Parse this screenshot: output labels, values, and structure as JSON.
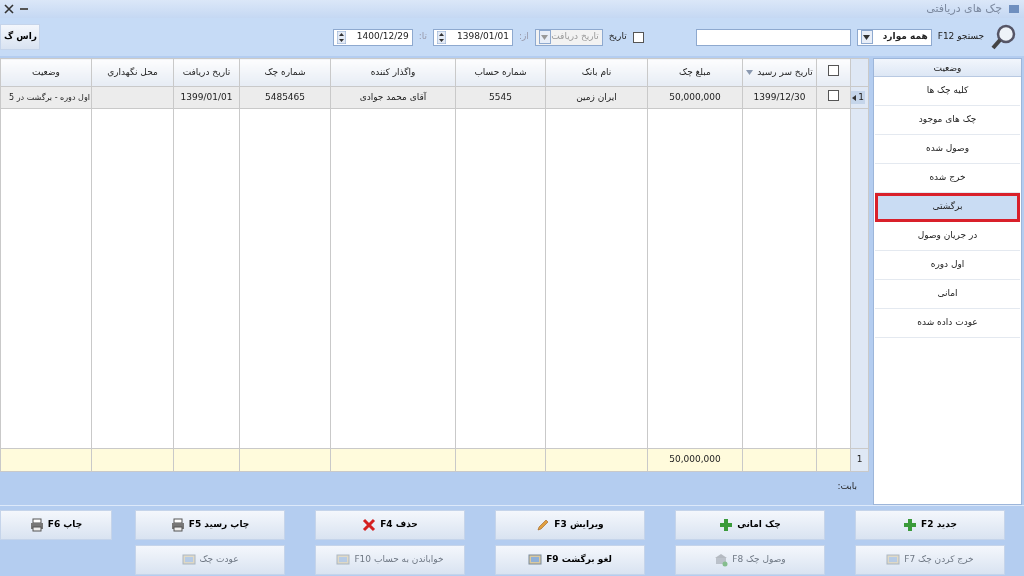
{
  "window": {
    "title": "چک های دریافتی"
  },
  "toolbar": {
    "search_label": "جستجو F12",
    "scope": "همه موارد",
    "date_filter": {
      "label": "تاریخ",
      "checked": false
    },
    "date_field": "تاریخ دریافت",
    "from_label": "از:",
    "from": "1398/01/01",
    "to_label": "تا:",
    "to": "1400/12/29",
    "side_button": "راس گ"
  },
  "table": {
    "select_all": {
      "checked": false
    },
    "columns": [
      {
        "kind": "text",
        "label": "تاریخ سر رسید",
        "sorted": true
      },
      {
        "kind": "amount",
        "label": "مبلغ چک",
        "sorted": false
      },
      {
        "kind": "text",
        "label": "نام بانک",
        "sorted": false
      },
      {
        "kind": "text",
        "label": "شماره حساب",
        "sorted": false
      },
      {
        "kind": "text",
        "label": "واگذار کننده",
        "sorted": false
      },
      {
        "kind": "text",
        "label": "شماره چک",
        "sorted": false
      },
      {
        "kind": "text",
        "label": "تاریخ دریافت",
        "sorted": false
      },
      {
        "kind": "text",
        "label": "محل نگهداري",
        "sorted": false
      },
      {
        "kind": "text",
        "label": "وضعیت",
        "sorted": false
      }
    ],
    "rows": [
      {
        "number": "1",
        "selected": true,
        "checked": false,
        "cells": [
          "1399/12/30",
          "50,000,000",
          "ايران زمين",
          "5545",
          "آقای محمد جوادی",
          "5485465",
          "1399/01/01",
          "",
          "اول دوره - برگشت در 5"
        ]
      }
    ],
    "summary": {
      "count": "1",
      "amount": "50,000,000"
    }
  },
  "memo_label": "بابت:",
  "sidebar": {
    "title": "وضعیت",
    "items": [
      {
        "label": "کلیه چک ها",
        "selected": false
      },
      {
        "label": "چک های موجود",
        "selected": false
      },
      {
        "label": "وصول شده",
        "selected": false
      },
      {
        "label": "خرج شده",
        "selected": false
      },
      {
        "label": "برگشتی",
        "selected": true
      },
      {
        "label": "در جریان وصول",
        "selected": false
      },
      {
        "label": "اول دوره",
        "selected": false
      },
      {
        "label": "امانی",
        "selected": false
      },
      {
        "label": "عودت داده شده",
        "selected": false
      }
    ]
  },
  "buttons": [
    [
      {
        "label": "جدید F2",
        "kind": "plus",
        "disabled": false
      },
      {
        "label": "چک امانی",
        "kind": "plus",
        "disabled": false
      },
      {
        "label": "ویرایش F3",
        "kind": "pencil",
        "disabled": false
      },
      {
        "label": "حذف F4",
        "kind": "cross",
        "disabled": false
      },
      {
        "label": "چاپ رسید F5",
        "kind": "printer",
        "disabled": false
      },
      {
        "label": "چاپ F6",
        "kind": "printer",
        "disabled": false
      }
    ],
    [
      {
        "label": "خرج کردن چک F7",
        "kind": "doc",
        "disabled": true
      },
      {
        "label": "وصول چک F8",
        "kind": "bank",
        "disabled": true
      },
      {
        "label": "لغو برگشت F9",
        "kind": "doc",
        "disabled": false
      },
      {
        "label": "خواباندن به حساب F10",
        "kind": "doc",
        "disabled": true
      },
      {
        "label": "عودت چک",
        "kind": "doc",
        "disabled": true
      }
    ]
  ]
}
